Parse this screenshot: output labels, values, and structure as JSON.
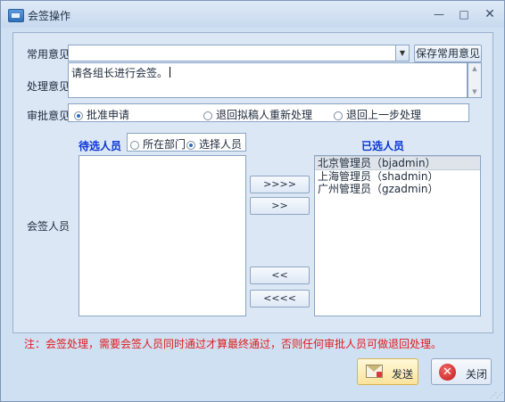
{
  "window": {
    "title": "会签操作",
    "minimize_glyph": "—",
    "maximize_glyph": "□",
    "close_glyph": "✕"
  },
  "form": {
    "common_opinion_label": "常用意见",
    "common_opinion_value": "",
    "save_common_button": "保存常用意见",
    "processing_opinion_label": "处理意见",
    "processing_opinion_value": "请各组长进行会签。",
    "approval_label": "审批意见",
    "approval_options": [
      {
        "label": "批准申请",
        "checked": true
      },
      {
        "label": "退回拟稿人重新处理",
        "checked": false
      },
      {
        "label": "退回上一步处理",
        "checked": false
      }
    ],
    "countersign_label": "会签人员"
  },
  "candidates": {
    "title": "待选人员",
    "filter_options": [
      {
        "label": "所在部门",
        "checked": false
      },
      {
        "label": "选择人员",
        "checked": true
      }
    ],
    "items": []
  },
  "selected": {
    "title": "已选人员",
    "items": [
      {
        "label": "北京管理员（bjadmin）",
        "selected": true
      },
      {
        "label": "上海管理员（shadmin）",
        "selected": false
      },
      {
        "label": "广州管理员（gzadmin）",
        "selected": false
      }
    ]
  },
  "move_buttons": {
    "add_all": ">>>>",
    "add": ">>",
    "remove": "<<",
    "remove_all": "<<<<"
  },
  "note": "注：会签处理，需要会签人员同时通过才算最终通过，否则任何审批人员可做退回处理。",
  "actions": {
    "send": "发送",
    "close": "关闭"
  },
  "icons": {
    "title": "window-app-icon",
    "send": "envelope-icon",
    "close": "close-circle-icon"
  }
}
